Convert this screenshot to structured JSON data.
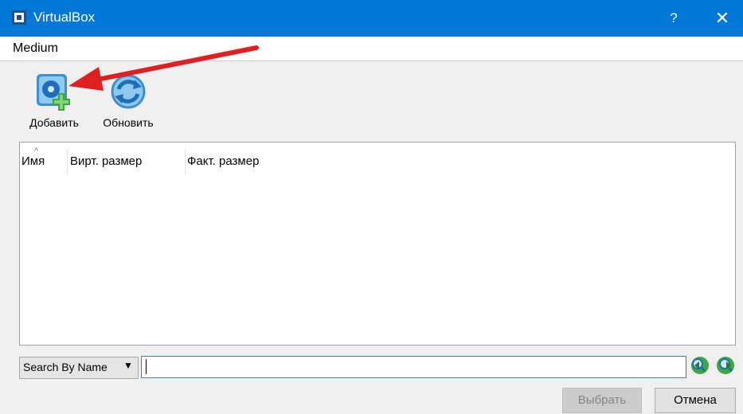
{
  "window": {
    "title": "VirtualBox",
    "help_label": "?",
    "close_label": "✕"
  },
  "subheader": {
    "title": "Medium"
  },
  "toolbar": {
    "add_label": "Добавить",
    "refresh_label": "Обновить"
  },
  "list": {
    "columns": [
      "Имя",
      "Вирт. размер",
      "Факт. размер"
    ],
    "sort_indicator": "^",
    "rows": []
  },
  "search": {
    "mode": "Search By Name",
    "value": ""
  },
  "buttons": {
    "choose": "Выбрать",
    "cancel": "Отмена"
  },
  "colors": {
    "titlebar": "#0078d7",
    "annotation_arrow": "#e02020"
  }
}
